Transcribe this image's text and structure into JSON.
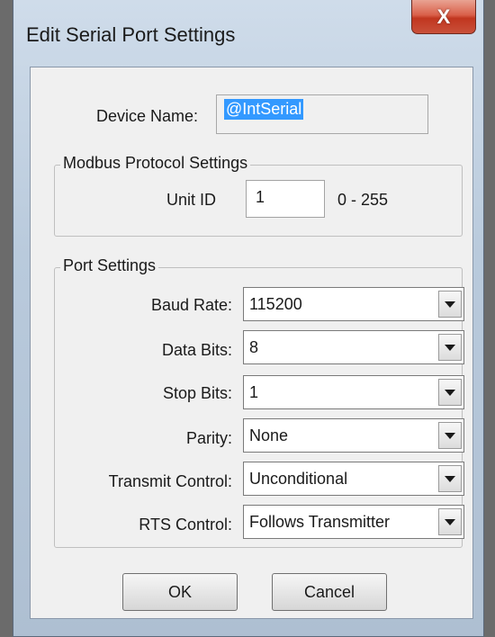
{
  "window": {
    "title": "Edit Serial Port Settings",
    "close_glyph": "X"
  },
  "device": {
    "label": "Device Name:",
    "value": "@IntSerial"
  },
  "modbus": {
    "legend": "Modbus Protocol Settings",
    "unit_id_label": "Unit ID",
    "unit_id_value": "1",
    "range_text": "0 - 255"
  },
  "port": {
    "legend": "Port Settings",
    "baud_rate": {
      "label": "Baud Rate:",
      "value": "115200"
    },
    "data_bits": {
      "label": "Data Bits:",
      "value": "8"
    },
    "stop_bits": {
      "label": "Stop Bits:",
      "value": "1"
    },
    "parity": {
      "label": "Parity:",
      "value": "None"
    },
    "transmit_control": {
      "label": "Transmit Control:",
      "value": "Unconditional"
    },
    "rts_control": {
      "label": "RTS Control:",
      "value": "Follows Transmitter"
    }
  },
  "buttons": {
    "ok": "OK",
    "cancel": "Cancel"
  }
}
